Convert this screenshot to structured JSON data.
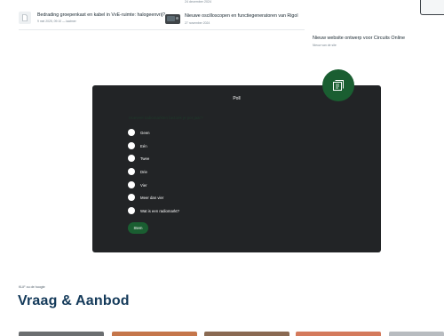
{
  "news": {
    "items": [
      {
        "title": "Bedrading groepenkast en kabel in VvE-ruimte: halogeenvrij?",
        "meta": "9 mei 2025, 09:10 — laatmer",
        "thumb": "doc-icon"
      },
      {
        "title": "Nieuwe oscilloscopen en functiegeneratoren van Rigol",
        "meta": "27 november 2024",
        "thumb": "oscilloscope-image"
      }
    ],
    "top_date": "24 december 2024"
  },
  "sidebar": {
    "title": "Nieuw website ontwerp voor Circuits Online",
    "meta": "Nieuw van de site"
  },
  "poll": {
    "label": "Poll",
    "question": "Hoeveel radiomarkten bezoek je per jaar?",
    "options": [
      "Geen",
      "Eén",
      "Twee",
      "Drie",
      "Vier",
      "Meer dan vier",
      "Wat is een radiomarkt?"
    ],
    "submit_label": "Stem",
    "badge_icon": "poll-icon"
  },
  "market": {
    "eyebrow": "KLIF ou de hoogte",
    "title": "Vraag & Aanbod"
  },
  "colors": {
    "accent": "#1a5e31",
    "poll_bg": "#222426",
    "heading": "#143a5a"
  }
}
